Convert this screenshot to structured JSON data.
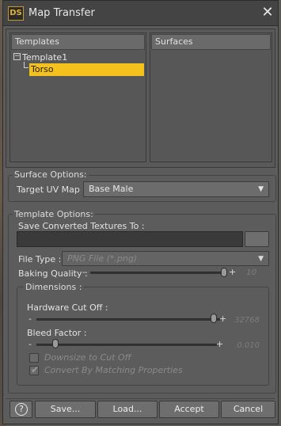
{
  "window": {
    "logo": "DS",
    "title": "Map Transfer",
    "close_glyph": "✕"
  },
  "templates": {
    "header": "Templates",
    "root": "Template1",
    "child": "Torso"
  },
  "surfaces": {
    "header": "Surfaces"
  },
  "surface_options": {
    "label": "Surface Options:",
    "target_uv_label": "Target UV Map :",
    "target_uv_value": "Base Male"
  },
  "template_options": {
    "label": "Template Options:",
    "save_label": "Save Converted Textures To :",
    "save_path": "",
    "file_type_label": "File Type :",
    "file_type_value": "PNG File (*.png)",
    "baking_quality_label": "Baking Quality :",
    "baking_quality_value": "10"
  },
  "dimensions": {
    "label": "Dimensions :",
    "hardware_label": "Hardware Cut Off :",
    "hardware_value": "32768",
    "bleed_label": "Bleed Factor :",
    "bleed_value": "0.010",
    "downsize_label": "Downsize to Cut Off",
    "convert_label": "Convert By Matching Properties"
  },
  "footer": {
    "help": "?",
    "save": "Save...",
    "load": "Load...",
    "accept": "Accept",
    "cancel": "Cancel"
  },
  "colors": {
    "selection": "#f5c11d",
    "accent": "#c79a2a"
  }
}
